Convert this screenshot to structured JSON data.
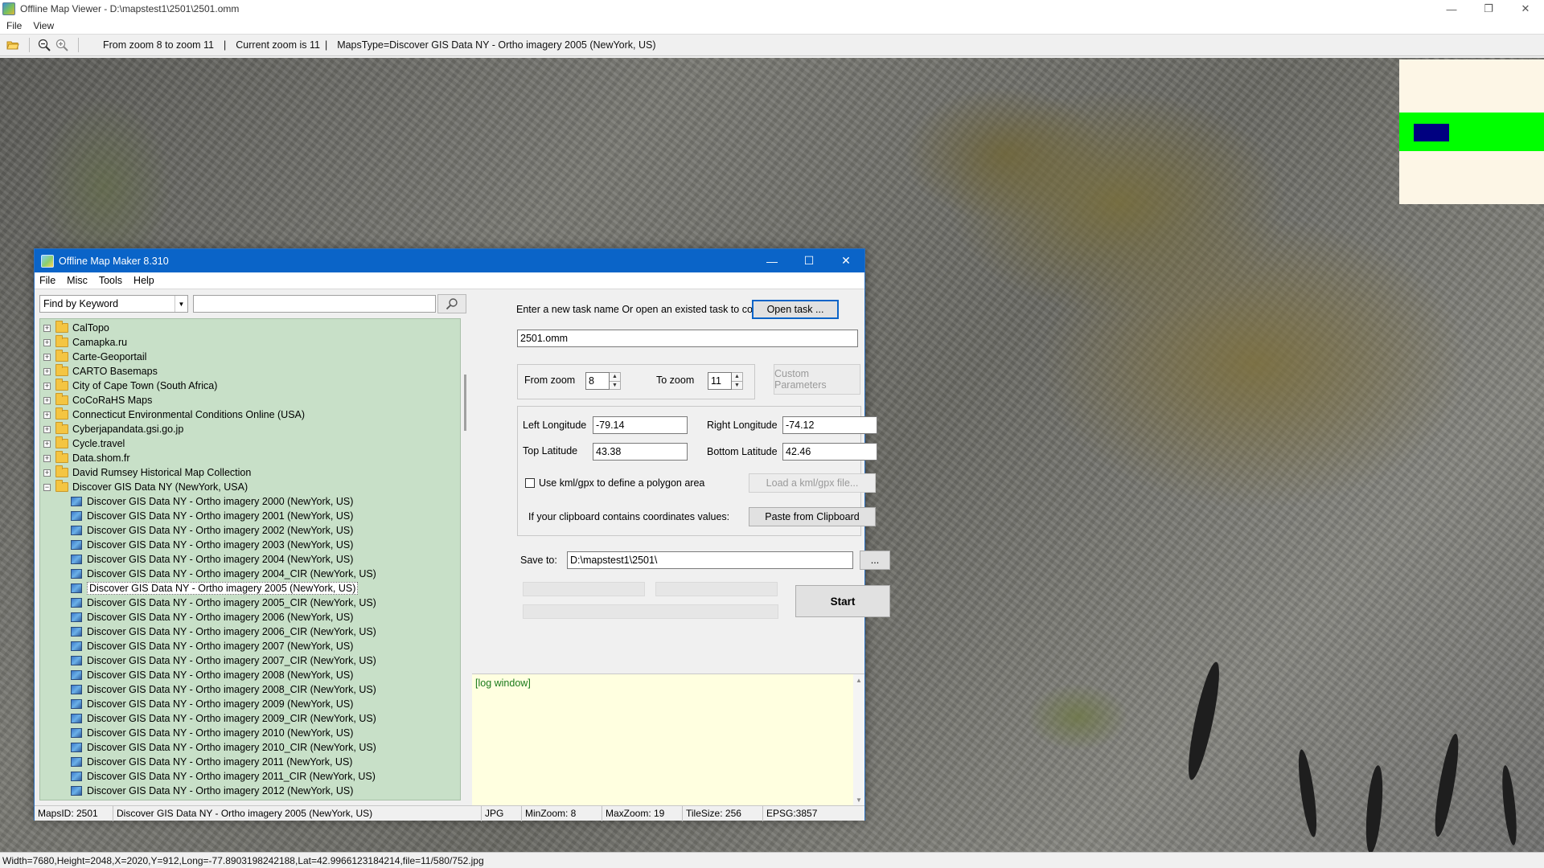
{
  "viewer": {
    "title": "Offline Map Viewer - D:\\mapstest1\\2501\\2501.omm",
    "menu": [
      "File",
      "View"
    ],
    "toolbar": {
      "zoom_range": "From zoom 8 to zoom 11",
      "current_zoom": "Current zoom is 11",
      "maps_type": "MapsType=Discover GIS Data NY - Ortho imagery 2005 (NewYork, US)",
      "sep": "|"
    },
    "status": "Width=7680,Height=2048,X=2020,Y=912,Long=-77.8903198242188,Lat=42.9966123184214,file=11/580/752.jpg"
  },
  "dialog": {
    "title": "Offline Map Maker 8.310",
    "menu": [
      "File",
      "Misc",
      "Tools",
      "Help"
    ],
    "search": {
      "mode": "Find by Keyword",
      "query": ""
    },
    "tree": [
      {
        "label": "CalTopo",
        "type": "folder",
        "expanded": false
      },
      {
        "label": "Camapka.ru",
        "type": "folder",
        "expanded": false
      },
      {
        "label": "Carte-Geoportail",
        "type": "folder",
        "expanded": false
      },
      {
        "label": "CARTO Basemaps",
        "type": "folder",
        "expanded": false
      },
      {
        "label": "City of Cape Town (South Africa)",
        "type": "folder",
        "expanded": false
      },
      {
        "label": "CoCoRaHS Maps",
        "type": "folder",
        "expanded": false
      },
      {
        "label": "Connecticut Environmental Conditions Online (USA)",
        "type": "folder",
        "expanded": false
      },
      {
        "label": "Cyberjapandata.gsi.go.jp",
        "type": "folder",
        "expanded": false
      },
      {
        "label": "Cycle.travel",
        "type": "folder",
        "expanded": false
      },
      {
        "label": "Data.shom.fr",
        "type": "folder",
        "expanded": false
      },
      {
        "label": "David Rumsey Historical Map Collection",
        "type": "folder",
        "expanded": false
      },
      {
        "label": "Discover GIS Data NY (NewYork, USA)",
        "type": "folder",
        "expanded": true
      },
      {
        "label": "Discover GIS Data NY - Ortho imagery 2000 (NewYork, US)",
        "type": "map"
      },
      {
        "label": "Discover GIS Data NY - Ortho imagery 2001 (NewYork, US)",
        "type": "map"
      },
      {
        "label": "Discover GIS Data NY - Ortho imagery 2002 (NewYork, US)",
        "type": "map"
      },
      {
        "label": "Discover GIS Data NY - Ortho imagery 2003 (NewYork, US)",
        "type": "map"
      },
      {
        "label": "Discover GIS Data NY - Ortho imagery 2004 (NewYork, US)",
        "type": "map"
      },
      {
        "label": "Discover GIS Data NY - Ortho imagery 2004_CIR (NewYork, US)",
        "type": "map"
      },
      {
        "label": "Discover GIS Data NY - Ortho imagery 2005 (NewYork, US)",
        "type": "map",
        "selected": true
      },
      {
        "label": "Discover GIS Data NY - Ortho imagery 2005_CIR (NewYork, US)",
        "type": "map"
      },
      {
        "label": "Discover GIS Data NY - Ortho imagery 2006 (NewYork, US)",
        "type": "map"
      },
      {
        "label": "Discover GIS Data NY - Ortho imagery 2006_CIR (NewYork, US)",
        "type": "map"
      },
      {
        "label": "Discover GIS Data NY - Ortho imagery 2007 (NewYork, US)",
        "type": "map"
      },
      {
        "label": "Discover GIS Data NY - Ortho imagery 2007_CIR (NewYork, US)",
        "type": "map"
      },
      {
        "label": "Discover GIS Data NY - Ortho imagery 2008 (NewYork, US)",
        "type": "map"
      },
      {
        "label": "Discover GIS Data NY - Ortho imagery 2008_CIR (NewYork, US)",
        "type": "map"
      },
      {
        "label": "Discover GIS Data NY - Ortho imagery 2009 (NewYork, US)",
        "type": "map"
      },
      {
        "label": "Discover GIS Data NY - Ortho imagery 2009_CIR (NewYork, US)",
        "type": "map"
      },
      {
        "label": "Discover GIS Data NY - Ortho imagery 2010 (NewYork, US)",
        "type": "map"
      },
      {
        "label": "Discover GIS Data NY - Ortho imagery 2010_CIR (NewYork, US)",
        "type": "map"
      },
      {
        "label": "Discover GIS Data NY - Ortho imagery 2011 (NewYork, US)",
        "type": "map"
      },
      {
        "label": "Discover GIS Data NY - Ortho imagery 2011_CIR (NewYork, US)",
        "type": "map"
      },
      {
        "label": "Discover GIS Data NY - Ortho imagery 2012 (NewYork, US)",
        "type": "map"
      }
    ],
    "task": {
      "prompt": "Enter a new task name Or open an existed task to continue:",
      "open_button": "Open task ...",
      "name": "2501.omm"
    },
    "zoom": {
      "from_label": "From zoom",
      "from_value": "8",
      "to_label": "To zoom",
      "to_value": "11",
      "custom_button": "Custom Parameters"
    },
    "area": {
      "left_lon_label": "Left Longitude",
      "left_lon": "-79.14",
      "right_lon_label": "Right Longitude",
      "right_lon": "-74.12",
      "top_lat_label": "Top Latitude",
      "top_lat": "43.38",
      "bottom_lat_label": "Bottom Latitude",
      "bottom_lat": "42.46",
      "kml_checkbox_label": "Use kml/gpx to define a polygon area",
      "kml_checked": false,
      "load_kml_button": "Load a kml/gpx file...",
      "clipboard_label": "If your clipboard contains coordinates values:",
      "paste_button": "Paste from Clipboard"
    },
    "save": {
      "label": "Save to:",
      "path": "D:\\mapstest1\\2501\\",
      "browse_button": "..."
    },
    "start_button": "Start",
    "log": "[log window]",
    "status": {
      "maps_id": "MapsID: 2501",
      "map_name": "Discover GIS Data NY - Ortho imagery 2005 (NewYork, US)",
      "format": "JPG",
      "min_zoom": "MinZoom: 8",
      "max_zoom": "MaxZoom: 19",
      "tile_size": "TileSize: 256",
      "epsg": "EPSG:3857"
    }
  },
  "colors": {
    "dialog_title": "#0a64c8",
    "tree_bg": "#c8e0c8",
    "log_bg": "#ffffe0",
    "legend_green": "#00ff00",
    "legend_blue": "#000080"
  }
}
